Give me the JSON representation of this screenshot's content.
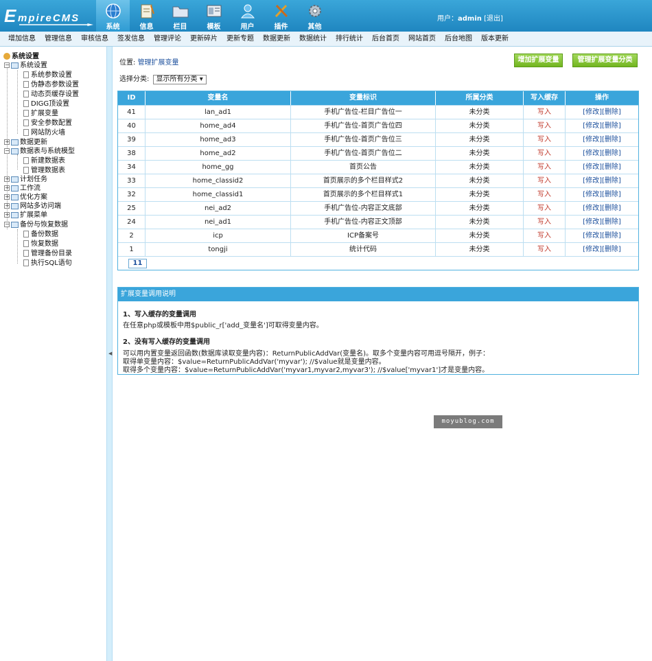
{
  "header": {
    "logo": {
      "initial": "E",
      "rest": "mpireCMS"
    },
    "topnav": [
      {
        "label": "系统",
        "icon": "globe-icon"
      },
      {
        "label": "信息",
        "icon": "notepad-icon"
      },
      {
        "label": "栏目",
        "icon": "folder-icon"
      },
      {
        "label": "模板",
        "icon": "template-icon"
      },
      {
        "label": "用户",
        "icon": "user-icon"
      },
      {
        "label": "插件",
        "icon": "tools-icon"
      },
      {
        "label": "其他",
        "icon": "gear-icon"
      }
    ],
    "user_label": "用户：",
    "username": "admin",
    "logout": "[退出]"
  },
  "menubar": [
    "增加信息",
    "管理信息",
    "审核信息",
    "签发信息",
    "管理评论",
    "更新碎片",
    "更新专题",
    "数据更新",
    "数据统计",
    "排行统计",
    "后台首页",
    "网站首页",
    "后台地图",
    "版本更新"
  ],
  "sidebar": {
    "root": "系统设置",
    "items": [
      {
        "label": "系统设置",
        "level": 1,
        "expanded": true
      },
      {
        "label": "系统参数设置",
        "level": 2
      },
      {
        "label": "伪静态参数设置",
        "level": 2
      },
      {
        "label": "动态页缓存设置",
        "level": 2
      },
      {
        "label": "DIGG顶设置",
        "level": 2
      },
      {
        "label": "扩展变量",
        "level": 2
      },
      {
        "label": "安全参数配置",
        "level": 2
      },
      {
        "label": "网站防火墙",
        "level": 2
      },
      {
        "label": "数据更新",
        "level": 1,
        "expanded": false
      },
      {
        "label": "数据表与系统模型",
        "level": 1,
        "expanded": true
      },
      {
        "label": "新建数据表",
        "level": 2
      },
      {
        "label": "管理数据表",
        "level": 2
      },
      {
        "label": "计划任务",
        "level": 1,
        "expanded": false
      },
      {
        "label": "工作流",
        "level": 1,
        "expanded": false
      },
      {
        "label": "优化方案",
        "level": 1,
        "expanded": false
      },
      {
        "label": "网站多访问端",
        "level": 1,
        "expanded": false
      },
      {
        "label": "扩展菜单",
        "level": 1,
        "expanded": false
      },
      {
        "label": "备份与恢复数据",
        "level": 1,
        "expanded": true
      },
      {
        "label": "备份数据",
        "level": 2
      },
      {
        "label": "恢复数据",
        "level": 2
      },
      {
        "label": "管理备份目录",
        "level": 2
      },
      {
        "label": "执行SQL语句",
        "level": 2
      }
    ]
  },
  "main": {
    "location_label": "位置: ",
    "location_link": "管理扩展变量",
    "btn_add": "增加扩展变量",
    "btn_manage_class": "管理扩展变量分类",
    "filter_label": "选择分类:",
    "filter_value": "显示所有分类",
    "table": {
      "headers": [
        "ID",
        "变量名",
        "变量标识",
        "所属分类",
        "写入缓存",
        "操作"
      ],
      "rows": [
        {
          "id": "41",
          "name": "lan_ad1",
          "tag": "手机广告位-栏目广告位一",
          "class": "未分类",
          "write": "写入"
        },
        {
          "id": "40",
          "name": "home_ad4",
          "tag": "手机广告位-首页广告位四",
          "class": "未分类",
          "write": "写入"
        },
        {
          "id": "39",
          "name": "home_ad3",
          "tag": "手机广告位-首页广告位三",
          "class": "未分类",
          "write": "写入"
        },
        {
          "id": "38",
          "name": "home_ad2",
          "tag": "手机广告位-首页广告位二",
          "class": "未分类",
          "write": "写入"
        },
        {
          "id": "34",
          "name": "home_gg",
          "tag": "首页公告",
          "class": "未分类",
          "write": "写入"
        },
        {
          "id": "33",
          "name": "home_classid2",
          "tag": "首页展示的多个栏目样式2",
          "class": "未分类",
          "write": "写入"
        },
        {
          "id": "32",
          "name": "home_classid1",
          "tag": "首页展示的多个栏目样式1",
          "class": "未分类",
          "write": "写入"
        },
        {
          "id": "25",
          "name": "nei_ad2",
          "tag": "手机广告位-内容正文底部",
          "class": "未分类",
          "write": "写入"
        },
        {
          "id": "24",
          "name": "nei_ad1",
          "tag": "手机广告位-内容正文顶部",
          "class": "未分类",
          "write": "写入"
        },
        {
          "id": "2",
          "name": "icp",
          "tag": "ICP备案号",
          "class": "未分类",
          "write": "写入"
        },
        {
          "id": "1",
          "name": "tongji",
          "tag": "统计代码",
          "class": "未分类",
          "write": "写入"
        }
      ],
      "edit_label": "[修改]",
      "delete_label": "[删除]",
      "page": "11"
    },
    "help": {
      "title": "扩展变量调用说明",
      "s1_title": "1、写入缓存的变量调用",
      "s1_text": "在任意php或模板中用$public_r['add_变量名']可取得变量内容。",
      "s2_title": "2、没有写入缓存的变量调用",
      "s2_line1": "可以用内置变量返回函数(数据库读取变量内容)：ReturnPublicAddVar(变量名)。取多个变量内容可用逗号隔开，例子：",
      "s2_line2": "取得单变量内容：$value=ReturnPublicAddVar('myvar'); //$value就是变量内容。",
      "s2_line3": "取得多个变量内容：$value=ReturnPublicAddVar('myvar1,myvar2,myvar3'); //$value['myvar1']才是变量内容。"
    },
    "watermark": "moyublog.com"
  }
}
